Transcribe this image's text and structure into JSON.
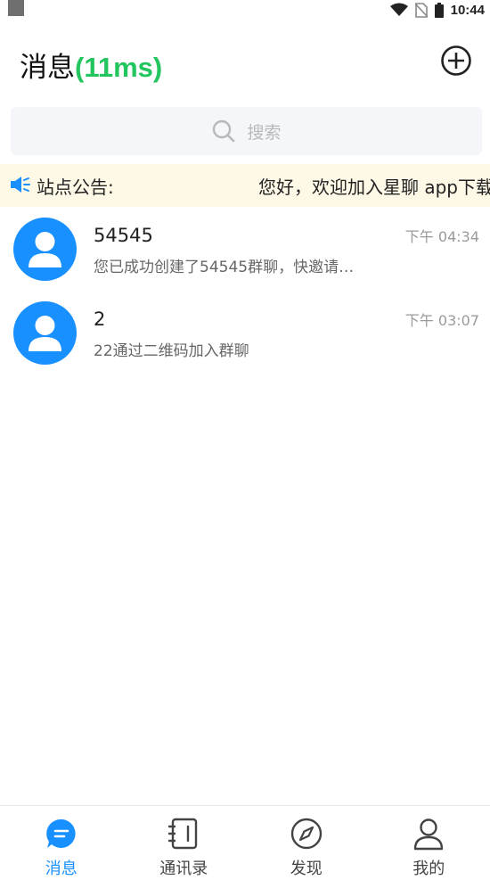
{
  "status_bar": {
    "time": "10:44"
  },
  "header": {
    "title": "消息",
    "latency": "(11ms)"
  },
  "search": {
    "placeholder": "搜索"
  },
  "announcement": {
    "label": "站点公告:",
    "text": "您好，欢迎加入星聊 app下载"
  },
  "messages": [
    {
      "name": "54545",
      "preview": "您已成功创建了54545群聊，快邀请…",
      "time": "下午 04:34"
    },
    {
      "name": "2",
      "preview": "22通过二维码加入群聊",
      "time": "下午 03:07"
    }
  ],
  "nav": {
    "items": [
      {
        "label": "消息",
        "icon": "chat-icon",
        "active": true
      },
      {
        "label": "通讯录",
        "icon": "contacts-book-icon",
        "active": false
      },
      {
        "label": "发现",
        "icon": "compass-icon",
        "active": false
      },
      {
        "label": "我的",
        "icon": "user-icon",
        "active": false
      }
    ]
  },
  "colors": {
    "accent": "#1890ff",
    "latency": "#22c55e",
    "announcement_bg": "#fef8e6",
    "search_bg": "#f4f6fa"
  }
}
